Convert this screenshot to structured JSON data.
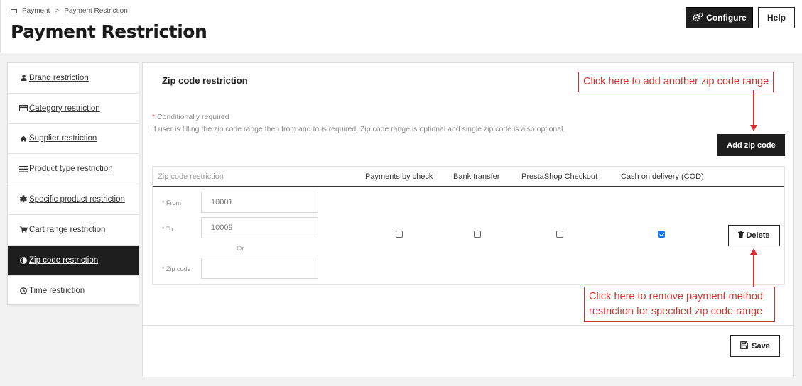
{
  "breadcrumb": {
    "parent": "Payment",
    "separator": ">",
    "current": "Payment Restriction"
  },
  "page_title": "Payment Restriction",
  "toolbar": {
    "configure_label": "Configure",
    "help_label": "Help"
  },
  "sidebar": {
    "items": [
      {
        "label": "Brand restriction",
        "icon": "user-icon",
        "active": false
      },
      {
        "label": "Category restriction",
        "icon": "credit-card-icon",
        "active": false
      },
      {
        "label": "Supplier restriction",
        "icon": "home-icon",
        "active": false
      },
      {
        "label": "Product type restriction",
        "icon": "list-icon",
        "active": false
      },
      {
        "label": "Specific product restriction",
        "icon": "asterisk-icon",
        "active": false
      },
      {
        "label": "Cart range restriction",
        "icon": "cart-icon",
        "active": false
      },
      {
        "label": "Zip code restriction",
        "icon": "half-circle-icon",
        "active": true
      },
      {
        "label": "Time restriction",
        "icon": "clock-icon",
        "active": false
      }
    ]
  },
  "main": {
    "section_title": "Zip code restriction",
    "required_star": "*",
    "required_note": "Conditionally required",
    "help_text": "If user is filling the zip code range then from and to is required. Zip code range is optional and single zip code is also optional.",
    "add_zip_label": "Add zip code",
    "table": {
      "headers": [
        "Zip code restriction",
        "Payments by check",
        "Bank transfer",
        "PrestaShop Checkout",
        "Cash on delivery (COD)"
      ],
      "row": {
        "from_label": "* From",
        "from_value": "10001",
        "to_label": "* To",
        "to_value": "10009",
        "or_label": "Or",
        "zip_label": "* Zip code",
        "zip_value": "",
        "payments": [
          {
            "method": "Payments by check",
            "checked": false
          },
          {
            "method": "Bank transfer",
            "checked": false
          },
          {
            "method": "PrestaShop Checkout",
            "checked": false
          },
          {
            "method": "Cash on delivery (COD)",
            "checked": true
          }
        ],
        "delete_label": "Delete"
      }
    },
    "save_label": "Save"
  },
  "annotations": {
    "add_hint": "Click here to add another zip code range",
    "delete_hint_line1": "Click here to remove payment method",
    "delete_hint_line2": "restriction for specified zip code range",
    "color": "#d93030"
  }
}
